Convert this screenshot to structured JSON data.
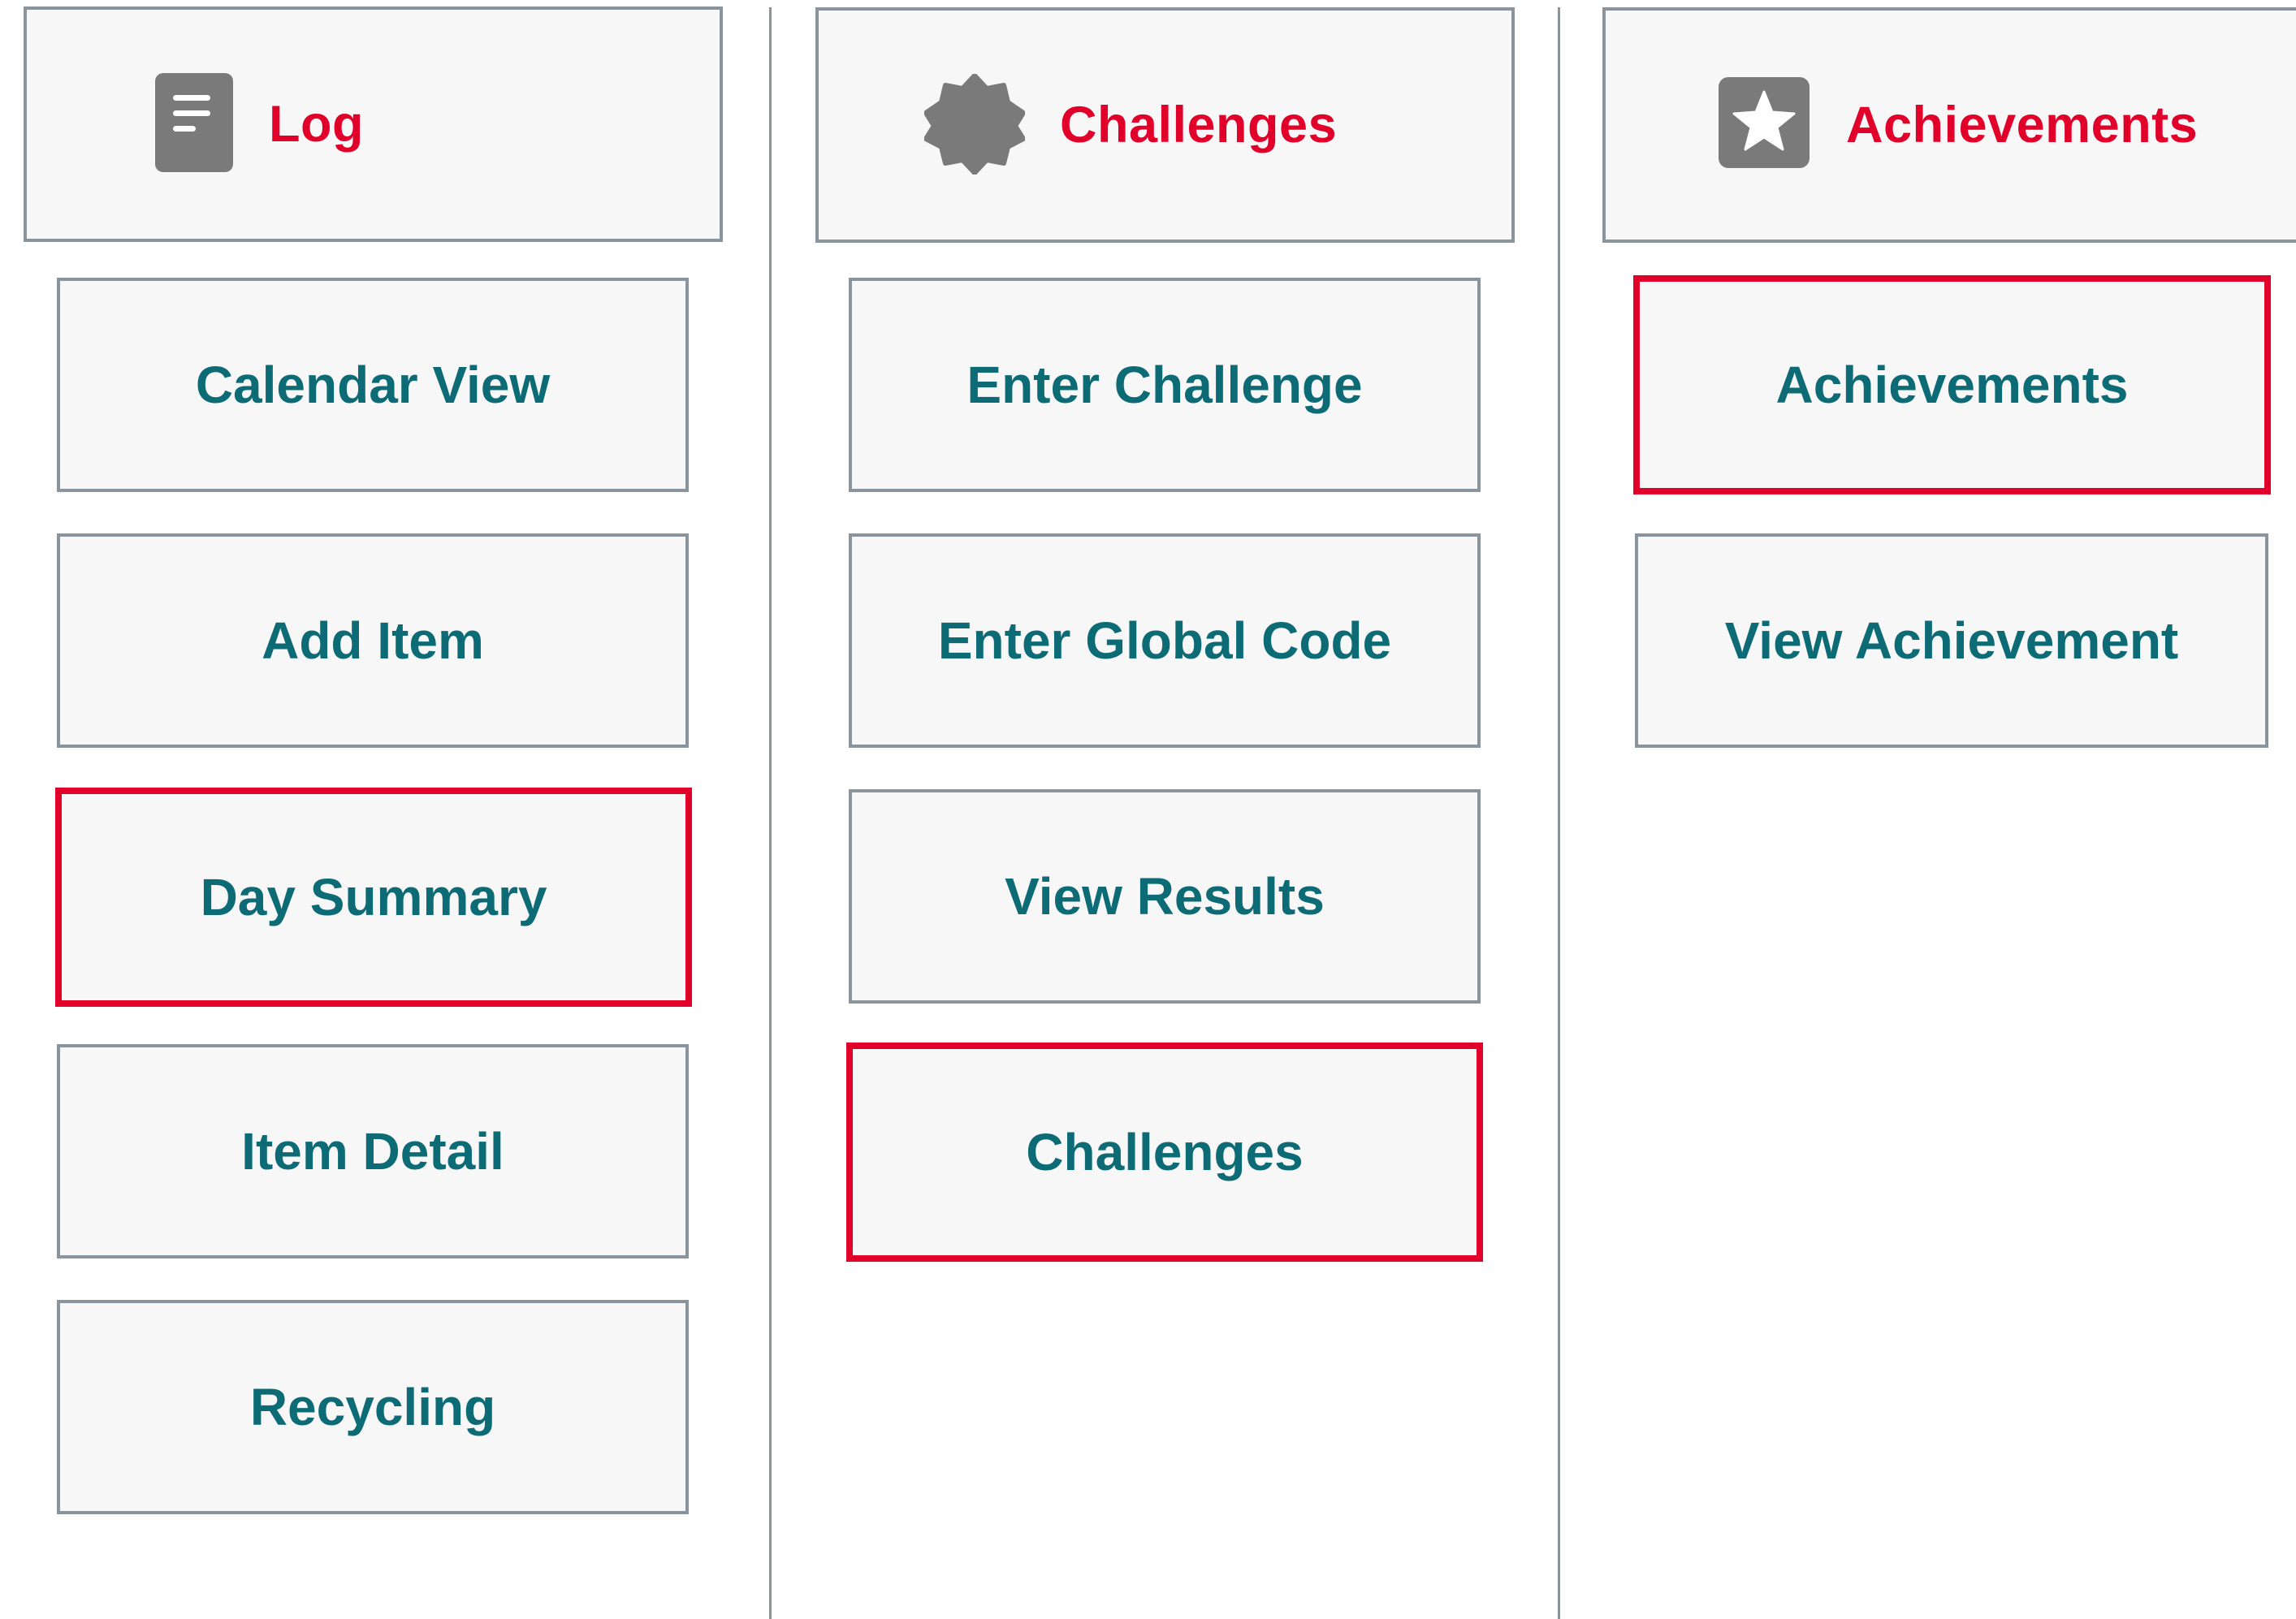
{
  "columns": [
    {
      "title": "Log",
      "icon": "document-icon",
      "items": [
        {
          "label": "Calendar View",
          "selected": false
        },
        {
          "label": "Add Item",
          "selected": false
        },
        {
          "label": "Day Summary",
          "selected": true
        },
        {
          "label": "Item Detail",
          "selected": false
        },
        {
          "label": "Recycling",
          "selected": false
        }
      ]
    },
    {
      "title": "Challenges",
      "icon": "badge-icon",
      "items": [
        {
          "label": "Enter Challenge",
          "selected": false
        },
        {
          "label": "Enter Global Code",
          "selected": false
        },
        {
          "label": "View Results",
          "selected": false
        },
        {
          "label": "Challenges",
          "selected": true
        }
      ]
    },
    {
      "title": "Achievements",
      "icon": "star-icon",
      "items": [
        {
          "label": "Achievements",
          "selected": true
        },
        {
          "label": "View Achievement",
          "selected": false
        }
      ]
    }
  ],
  "colors": {
    "accent_red": "#e1002a",
    "teal_text": "#0c6b75",
    "border_gray": "#8a949c",
    "icon_gray": "#7a7a7a",
    "box_bg": "#f7f7f7"
  }
}
